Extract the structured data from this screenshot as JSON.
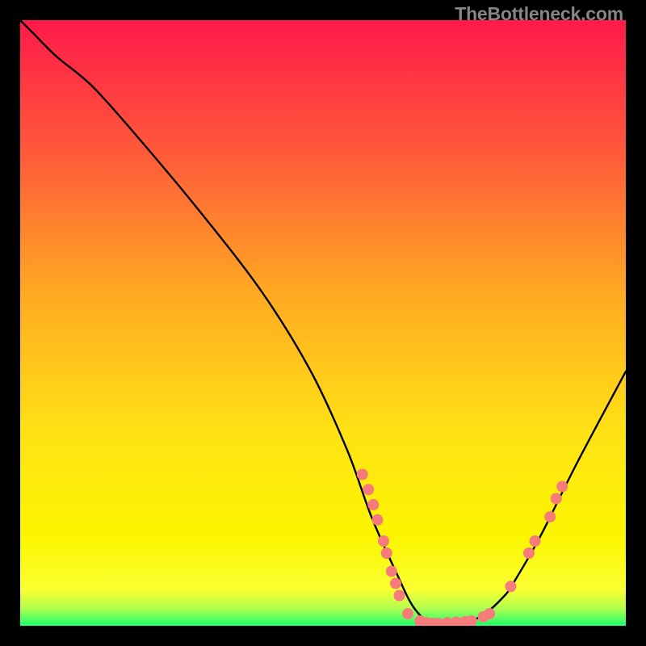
{
  "watermark": "TheBottleneck.com",
  "chart_data": {
    "type": "line",
    "title": "",
    "xlabel": "",
    "ylabel": "",
    "xlim": [
      0,
      100
    ],
    "ylim": [
      0,
      100
    ],
    "grid": false,
    "legend": false,
    "background_gradient": [
      "#ff1a4a",
      "#ff6a3a",
      "#ffd21f",
      "#fff200",
      "#fff200",
      "#1bff6b"
    ],
    "series": [
      {
        "name": "bottleneck-curve",
        "color": "#000000",
        "x": [
          0,
          2,
          6,
          12,
          20,
          30,
          40,
          48,
          54,
          58,
          62,
          65,
          68,
          72,
          76,
          80,
          82,
          86,
          92,
          100
        ],
        "y": [
          100,
          98,
          94,
          89,
          80,
          68,
          55,
          42,
          29,
          18,
          9,
          3,
          0.5,
          0.5,
          1.5,
          5,
          8,
          15,
          27,
          42
        ]
      }
    ],
    "markers": [
      {
        "x": 56.5,
        "y": 25
      },
      {
        "x": 57.5,
        "y": 22.5
      },
      {
        "x": 58.3,
        "y": 20
      },
      {
        "x": 59,
        "y": 17.5
      },
      {
        "x": 60,
        "y": 14
      },
      {
        "x": 60.5,
        "y": 12
      },
      {
        "x": 61.3,
        "y": 9
      },
      {
        "x": 62,
        "y": 7
      },
      {
        "x": 62.6,
        "y": 5
      },
      {
        "x": 64,
        "y": 2
      },
      {
        "x": 66,
        "y": 0.8
      },
      {
        "x": 67,
        "y": 0.5
      },
      {
        "x": 68,
        "y": 0.4
      },
      {
        "x": 69,
        "y": 0.4
      },
      {
        "x": 70.5,
        "y": 0.5
      },
      {
        "x": 72,
        "y": 0.6
      },
      {
        "x": 73.5,
        "y": 0.7
      },
      {
        "x": 74.5,
        "y": 0.8
      },
      {
        "x": 76.5,
        "y": 1.5
      },
      {
        "x": 77.5,
        "y": 2
      },
      {
        "x": 81,
        "y": 6.5
      },
      {
        "x": 84,
        "y": 12
      },
      {
        "x": 85,
        "y": 14
      },
      {
        "x": 87.5,
        "y": 18
      },
      {
        "x": 88.5,
        "y": 21
      },
      {
        "x": 89.5,
        "y": 23
      }
    ],
    "marker_color": "#f77b7b",
    "marker_radius": 7
  }
}
